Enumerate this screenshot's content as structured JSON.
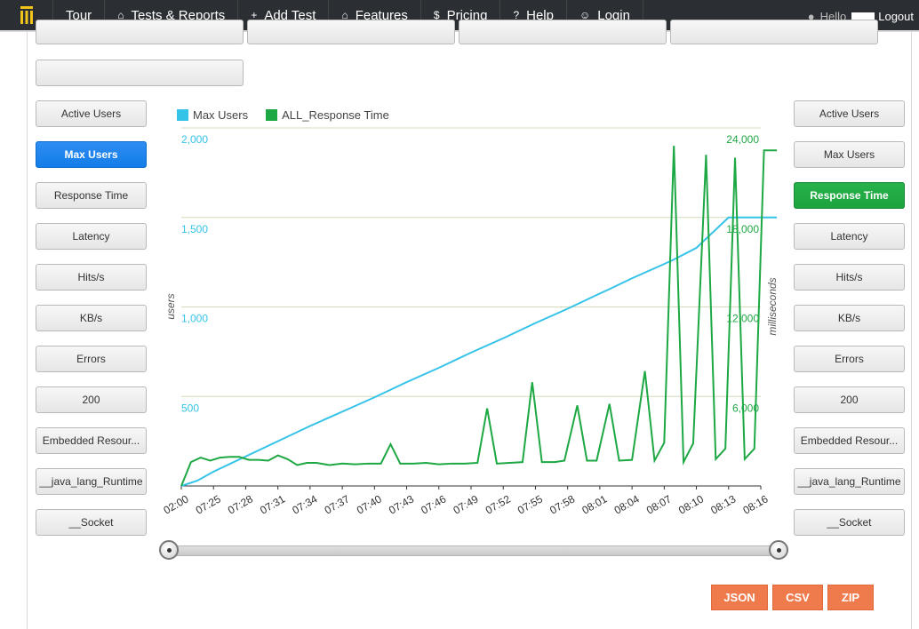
{
  "nav": {
    "items": [
      {
        "label": "Tour",
        "icon": ""
      },
      {
        "label": "Tests & Reports",
        "icon": "⌂"
      },
      {
        "label": "Add Test",
        "icon": "+"
      },
      {
        "label": "Features",
        "icon": "⌂"
      },
      {
        "label": "Pricing",
        "icon": "$"
      },
      {
        "label": "Help",
        "icon": "?"
      },
      {
        "label": "Login",
        "icon": "☺"
      }
    ],
    "hello": "Hello",
    "logout": "Logout"
  },
  "left_buttons": [
    "Active Users",
    "Max Users",
    "Response Time",
    "Latency",
    "Hits/s",
    "KB/s",
    "Errors",
    "200",
    "Embedded Resour...",
    "__java_lang_Runtime",
    "__Socket"
  ],
  "right_buttons": [
    "Active Users",
    "Max Users",
    "Response Time",
    "Latency",
    "Hits/s",
    "KB/s",
    "Errors",
    "200",
    "Embedded Resour...",
    "__java_lang_Runtime",
    "__Socket"
  ],
  "export": {
    "json": "JSON",
    "csv": "CSV",
    "zip": "ZIP"
  },
  "colors": {
    "max_users": "#35c3e8",
    "response_time": "#1ea844",
    "active_blue": "#137de8",
    "active_green": "#1ca33f"
  },
  "chart_data": {
    "type": "line",
    "legend": [
      "Max Users",
      "ALL_Response Time"
    ],
    "legend_position": "top-left",
    "y_left": {
      "label": "users",
      "ticks": [
        "500",
        "1,000",
        "1,500",
        "2,000"
      ],
      "range": [
        0,
        2000
      ]
    },
    "y_right": {
      "label": "milliseconds",
      "ticks": [
        "6,000",
        "12,000",
        "18,000",
        "24,000"
      ],
      "range": [
        0,
        24000
      ]
    },
    "x_ticks": [
      "02:00",
      "07:25",
      "07:28",
      "07:31",
      "07:34",
      "07:37",
      "07:40",
      "07:43",
      "07:46",
      "07:49",
      "07:52",
      "07:55",
      "07:58",
      "08:01",
      "08:04",
      "08:07",
      "08:10",
      "08:13",
      "08:16"
    ],
    "grid": true,
    "series": [
      {
        "name": "Max Users",
        "x_index": [
          0,
          0.5,
          1,
          2,
          3,
          4,
          5,
          6,
          7,
          8,
          9,
          10,
          11,
          12,
          13,
          13.3,
          14,
          15,
          15.3,
          16,
          17,
          17.5,
          18,
          18.5
        ],
        "values": [
          0,
          30,
          80,
          165,
          250,
          335,
          415,
          495,
          580,
          660,
          745,
          825,
          910,
          990,
          1075,
          1100,
          1160,
          1240,
          1265,
          1330,
          1500,
          1500,
          1500,
          1500
        ]
      },
      {
        "name": "ALL_Response Time",
        "x_index": [
          0,
          0.3,
          0.6,
          0.9,
          1.2,
          1.5,
          1.8,
          2.1,
          2.4,
          2.7,
          3.0,
          3.3,
          3.6,
          3.9,
          4.2,
          4.6,
          5.0,
          5.4,
          5.8,
          6.2,
          6.5,
          6.8,
          7.2,
          7.6,
          8.0,
          8.4,
          8.8,
          9.2,
          9.5,
          9.8,
          10.2,
          10.6,
          10.9,
          11.2,
          11.6,
          11.9,
          12.3,
          12.6,
          12.9,
          13.3,
          13.6,
          14.0,
          14.4,
          14.7,
          15.0,
          15.3,
          15.6,
          15.9,
          16.3,
          16.6,
          16.9,
          17.2,
          17.5,
          17.8,
          18.1,
          18.5
        ],
        "values": [
          0,
          1600,
          1900,
          1700,
          1900,
          1950,
          1950,
          1750,
          1750,
          1700,
          2050,
          1800,
          1400,
          1550,
          1550,
          1400,
          1500,
          1450,
          1500,
          1500,
          2800,
          1500,
          1500,
          1550,
          1450,
          1500,
          1500,
          1550,
          5200,
          1500,
          1550,
          1600,
          6950,
          1600,
          1600,
          1700,
          5400,
          1700,
          1700,
          5500,
          1700,
          1750,
          7700,
          1700,
          2900,
          22800,
          1600,
          2850,
          22200,
          1800,
          2500,
          22000,
          1800,
          2500,
          22500,
          22500
        ]
      }
    ]
  }
}
